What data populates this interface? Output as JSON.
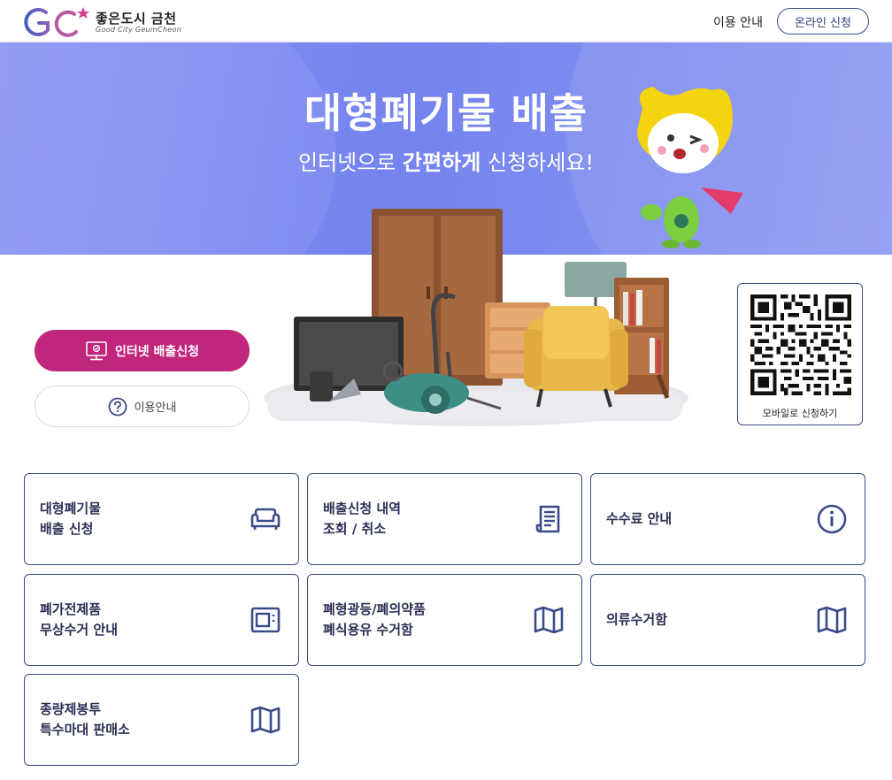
{
  "header": {
    "logo_name": "좋은도시 금천",
    "logo_sub": "Good City GeumCheon",
    "nav_guide": "이용 안내",
    "nav_apply": "온라인 신청"
  },
  "hero": {
    "title": "대형폐기물 배출",
    "subtitle_pre": "인터넷으로 ",
    "subtitle_bold": "간편하게",
    "subtitle_post": " 신청하세요!"
  },
  "actions": {
    "apply_label": "인터넷 배출신청",
    "guide_label": "이용안내"
  },
  "qr": {
    "label": "모바일로 신청하기"
  },
  "cards": [
    {
      "line1": "대형폐기물",
      "line2": "배출 신청",
      "icon": "sofa-icon"
    },
    {
      "line1": "배출신청 내역",
      "line2": "조회 / 취소",
      "icon": "receipt-icon"
    },
    {
      "line1": "수수료 안내",
      "line2": "",
      "icon": "info-icon"
    },
    {
      "line1": "폐가전제품",
      "line2": "무상수거 안내",
      "icon": "appliance-icon"
    },
    {
      "line1": "폐형광등/폐의약품",
      "line2": "폐식용유 수거함",
      "icon": "map-icon"
    },
    {
      "line1": "의류수거함",
      "line2": "",
      "icon": "map-icon"
    },
    {
      "line1": "종량제봉투",
      "line2": "특수마대 판매소",
      "icon": "map-icon"
    }
  ],
  "colors": {
    "accent": "#c0267c",
    "navy": "#3b4a8a",
    "hero": "#7483ee"
  }
}
